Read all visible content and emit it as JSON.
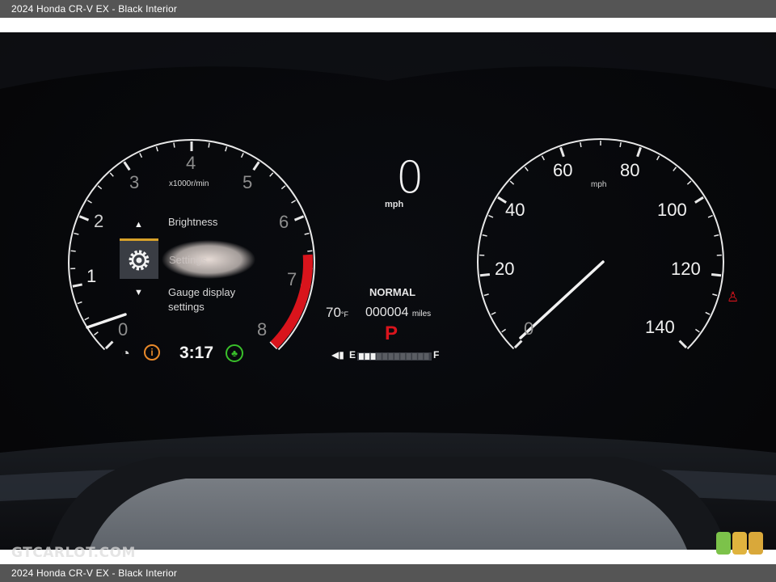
{
  "header": {
    "caption": "2024 Honda CR-V EX - Black Interior"
  },
  "footer": {
    "caption": "2024 Honda CR-V EX - Black Interior"
  },
  "watermark": "GTCARLOT.COM",
  "tachometer": {
    "unit": "x1000r/min",
    "ticks": [
      "0",
      "1",
      "2",
      "3",
      "4",
      "5",
      "6",
      "7",
      "8"
    ],
    "redline_color": "#d9141c"
  },
  "menu": {
    "up_arrow": "▲",
    "down_arrow": "▼",
    "items": [
      {
        "label": "Brightness"
      },
      {
        "label": "Settings"
      },
      {
        "label": "Gauge display settings",
        "line1": "Gauge display",
        "line2": "settings"
      }
    ],
    "selected_icon": "gear-icon"
  },
  "center": {
    "speed": "0",
    "speed_unit": "mph",
    "drive_mode": "NORMAL",
    "temperature": "70",
    "temperature_unit": "°F",
    "odometer": "000004",
    "odometer_unit": "miles",
    "gear": "P",
    "fuel_empty": "E",
    "fuel_full": "F",
    "fuel_level": 0.25
  },
  "status": {
    "clock": "3:17",
    "icons": [
      "gauge-warning-icon",
      "info-icon",
      "eco-icon"
    ]
  },
  "speedometer": {
    "unit": "mph",
    "ticks": [
      "0",
      "20",
      "40",
      "60",
      "80",
      "100",
      "120",
      "140"
    ]
  },
  "warning_icon": "seatbelt-icon",
  "colors": {
    "accent_red": "#d9141c",
    "eco_green": "#39c02a",
    "info_orange": "#e8892a",
    "menu_highlight": "#d7a12a"
  }
}
